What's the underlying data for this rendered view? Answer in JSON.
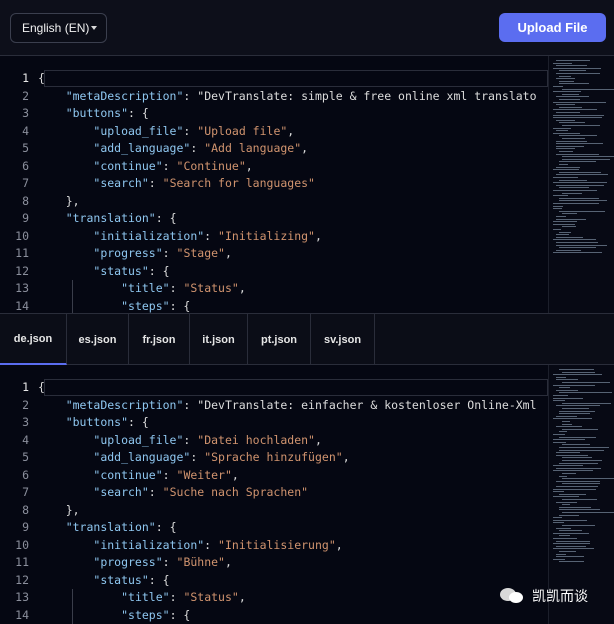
{
  "header": {
    "language_select": "English (EN)",
    "upload_button": "Upload File"
  },
  "top_editor": {
    "lines": [
      {
        "n": "1",
        "t": "{"
      },
      {
        "n": "2",
        "t": "    \"metaDescription\": \"DevTranslate: simple & free online xml translato"
      },
      {
        "n": "3",
        "t": "    \"buttons\": {"
      },
      {
        "n": "4",
        "t": "        \"upload_file\": \"Upload file\","
      },
      {
        "n": "5",
        "t": "        \"add_language\": \"Add language\","
      },
      {
        "n": "6",
        "t": "        \"continue\": \"Continue\","
      },
      {
        "n": "7",
        "t": "        \"search\": \"Search for languages\""
      },
      {
        "n": "8",
        "t": "    },"
      },
      {
        "n": "9",
        "t": "    \"translation\": {"
      },
      {
        "n": "10",
        "t": "        \"initialization\": \"Initializing\","
      },
      {
        "n": "11",
        "t": "        \"progress\": \"Stage\","
      },
      {
        "n": "12",
        "t": "        \"status\": {"
      },
      {
        "n": "13",
        "t": "            \"title\": \"Status\","
      },
      {
        "n": "14",
        "t": "            \"steps\": {"
      }
    ]
  },
  "tabs": [
    {
      "label": "de.json",
      "active": true
    },
    {
      "label": "es.json",
      "active": false
    },
    {
      "label": "fr.json",
      "active": false
    },
    {
      "label": "it.json",
      "active": false
    },
    {
      "label": "pt.json",
      "active": false
    },
    {
      "label": "sv.json",
      "active": false
    }
  ],
  "bottom_editor": {
    "lines": [
      {
        "n": "1",
        "t": "{"
      },
      {
        "n": "2",
        "t": "    \"metaDescription\": \"DevTranslate: einfacher & kostenloser Online-Xml"
      },
      {
        "n": "3",
        "t": "    \"buttons\": {"
      },
      {
        "n": "4",
        "t": "        \"upload_file\": \"Datei hochladen\","
      },
      {
        "n": "5",
        "t": "        \"add_language\": \"Sprache hinzufügen\","
      },
      {
        "n": "6",
        "t": "        \"continue\": \"Weiter\","
      },
      {
        "n": "7",
        "t": "        \"search\": \"Suche nach Sprachen\""
      },
      {
        "n": "8",
        "t": "    },"
      },
      {
        "n": "9",
        "t": "    \"translation\": {"
      },
      {
        "n": "10",
        "t": "        \"initialization\": \"Initialisierung\","
      },
      {
        "n": "11",
        "t": "        \"progress\": \"Bühne\","
      },
      {
        "n": "12",
        "t": "        \"status\": {"
      },
      {
        "n": "13",
        "t": "            \"title\": \"Status\","
      },
      {
        "n": "14",
        "t": "            \"steps\": {"
      }
    ]
  },
  "watermark": {
    "text": "凯凯而谈",
    "icon": "wechat-icon"
  },
  "colors": {
    "accent": "#5b6df0",
    "background": "#0b0d17",
    "key": "#8fc7f0",
    "string": "#d1946f"
  }
}
